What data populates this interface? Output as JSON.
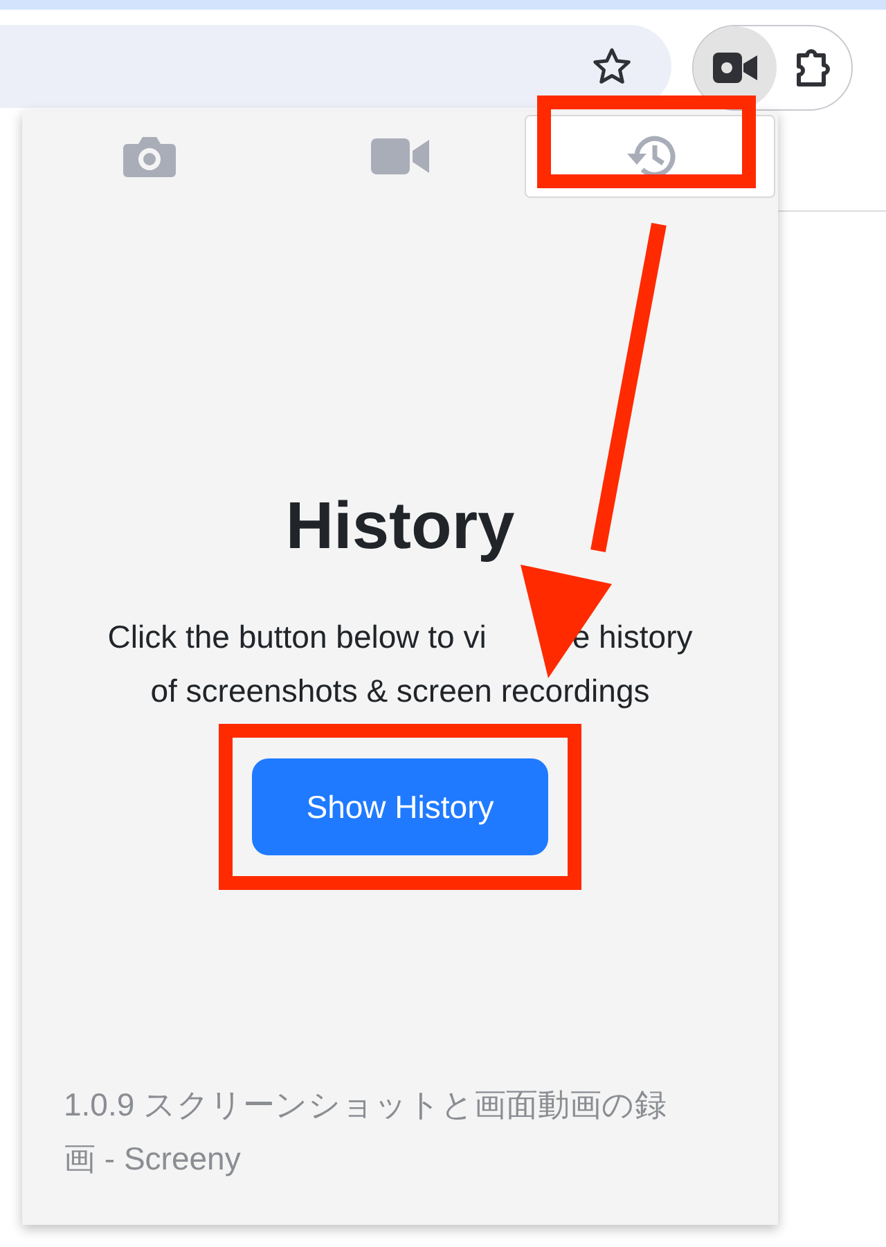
{
  "toolbar": {
    "extension_button": {
      "selected": true
    }
  },
  "tabs": [
    {
      "kind": "camera",
      "selected": false
    },
    {
      "kind": "video",
      "selected": false
    },
    {
      "kind": "history",
      "selected": true
    }
  ],
  "panel": {
    "title": "History",
    "description": {
      "line_1_start": "Click the button below to vi",
      "line_1_end": "e history",
      "line_2": "of screenshots & screen recordings"
    },
    "button": "Show History"
  },
  "footer": "1.0.9 スクリーンショットと画面動画の録画 - Screeny",
  "annotations": [
    {
      "kind": "box"
    },
    {
      "kind": "arrow"
    },
    {
      "kind": "box"
    }
  ]
}
